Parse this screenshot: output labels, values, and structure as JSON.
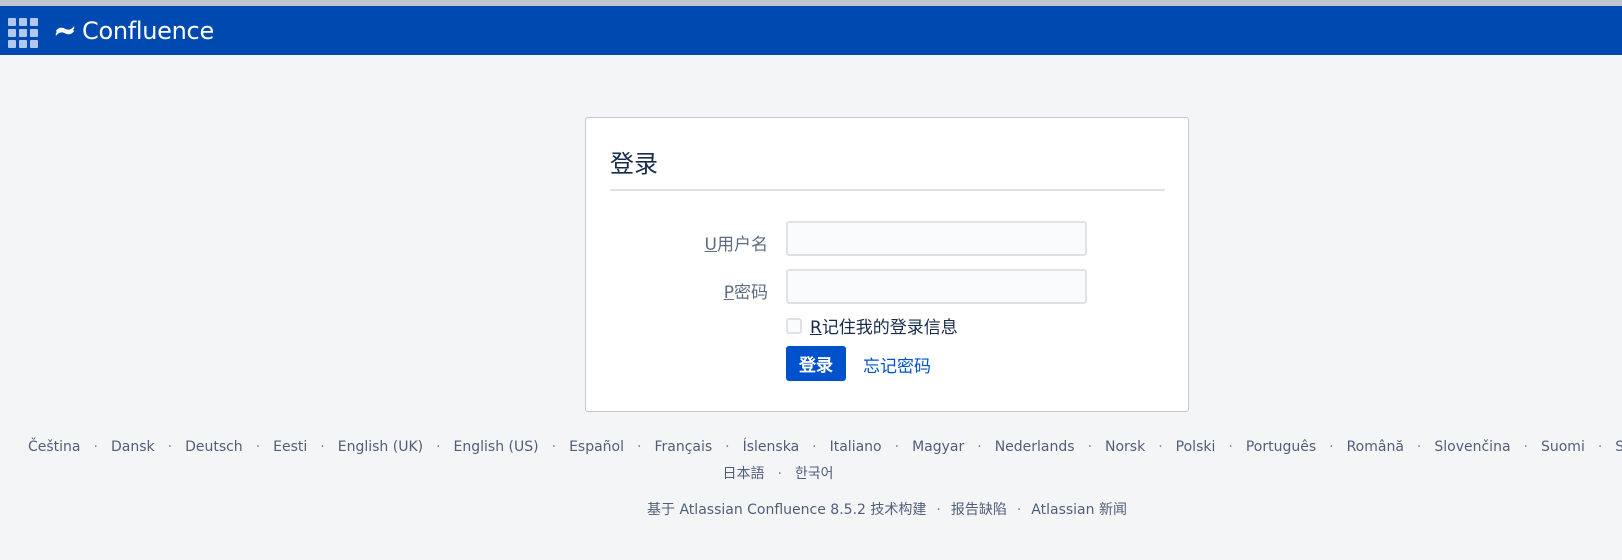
{
  "header": {
    "app_name": "Confluence",
    "brand_color": "#0049b0"
  },
  "login": {
    "title": "登录",
    "username_mnemonic": "U",
    "username_label": "用户名",
    "username_value": "",
    "password_mnemonic": "P",
    "password_label": "密码",
    "password_value": "",
    "remember_mnemonic": "R",
    "remember_label": "记住我的登录信息",
    "remember_checked": false,
    "submit_label": "登录",
    "forgot_label": "忘记密码"
  },
  "languages_row1": [
    "Čeština",
    "Dansk",
    "Deutsch",
    "Eesti",
    "English (UK)",
    "English (US)",
    "Español",
    "Français",
    "Íslenska",
    "Italiano",
    "Magyar",
    "Nederlands",
    "Norsk",
    "Polski",
    "Português",
    "Română",
    "Slovenčina",
    "Suomi",
    "Svens"
  ],
  "languages_row2": [
    "日本語",
    "한국어"
  ],
  "footer": {
    "powered_by": "基于 Atlassian Confluence 8.5.2 技术构建",
    "report_bug": "报告缺陷",
    "news": "Atlassian 新闻"
  },
  "separator": "·"
}
